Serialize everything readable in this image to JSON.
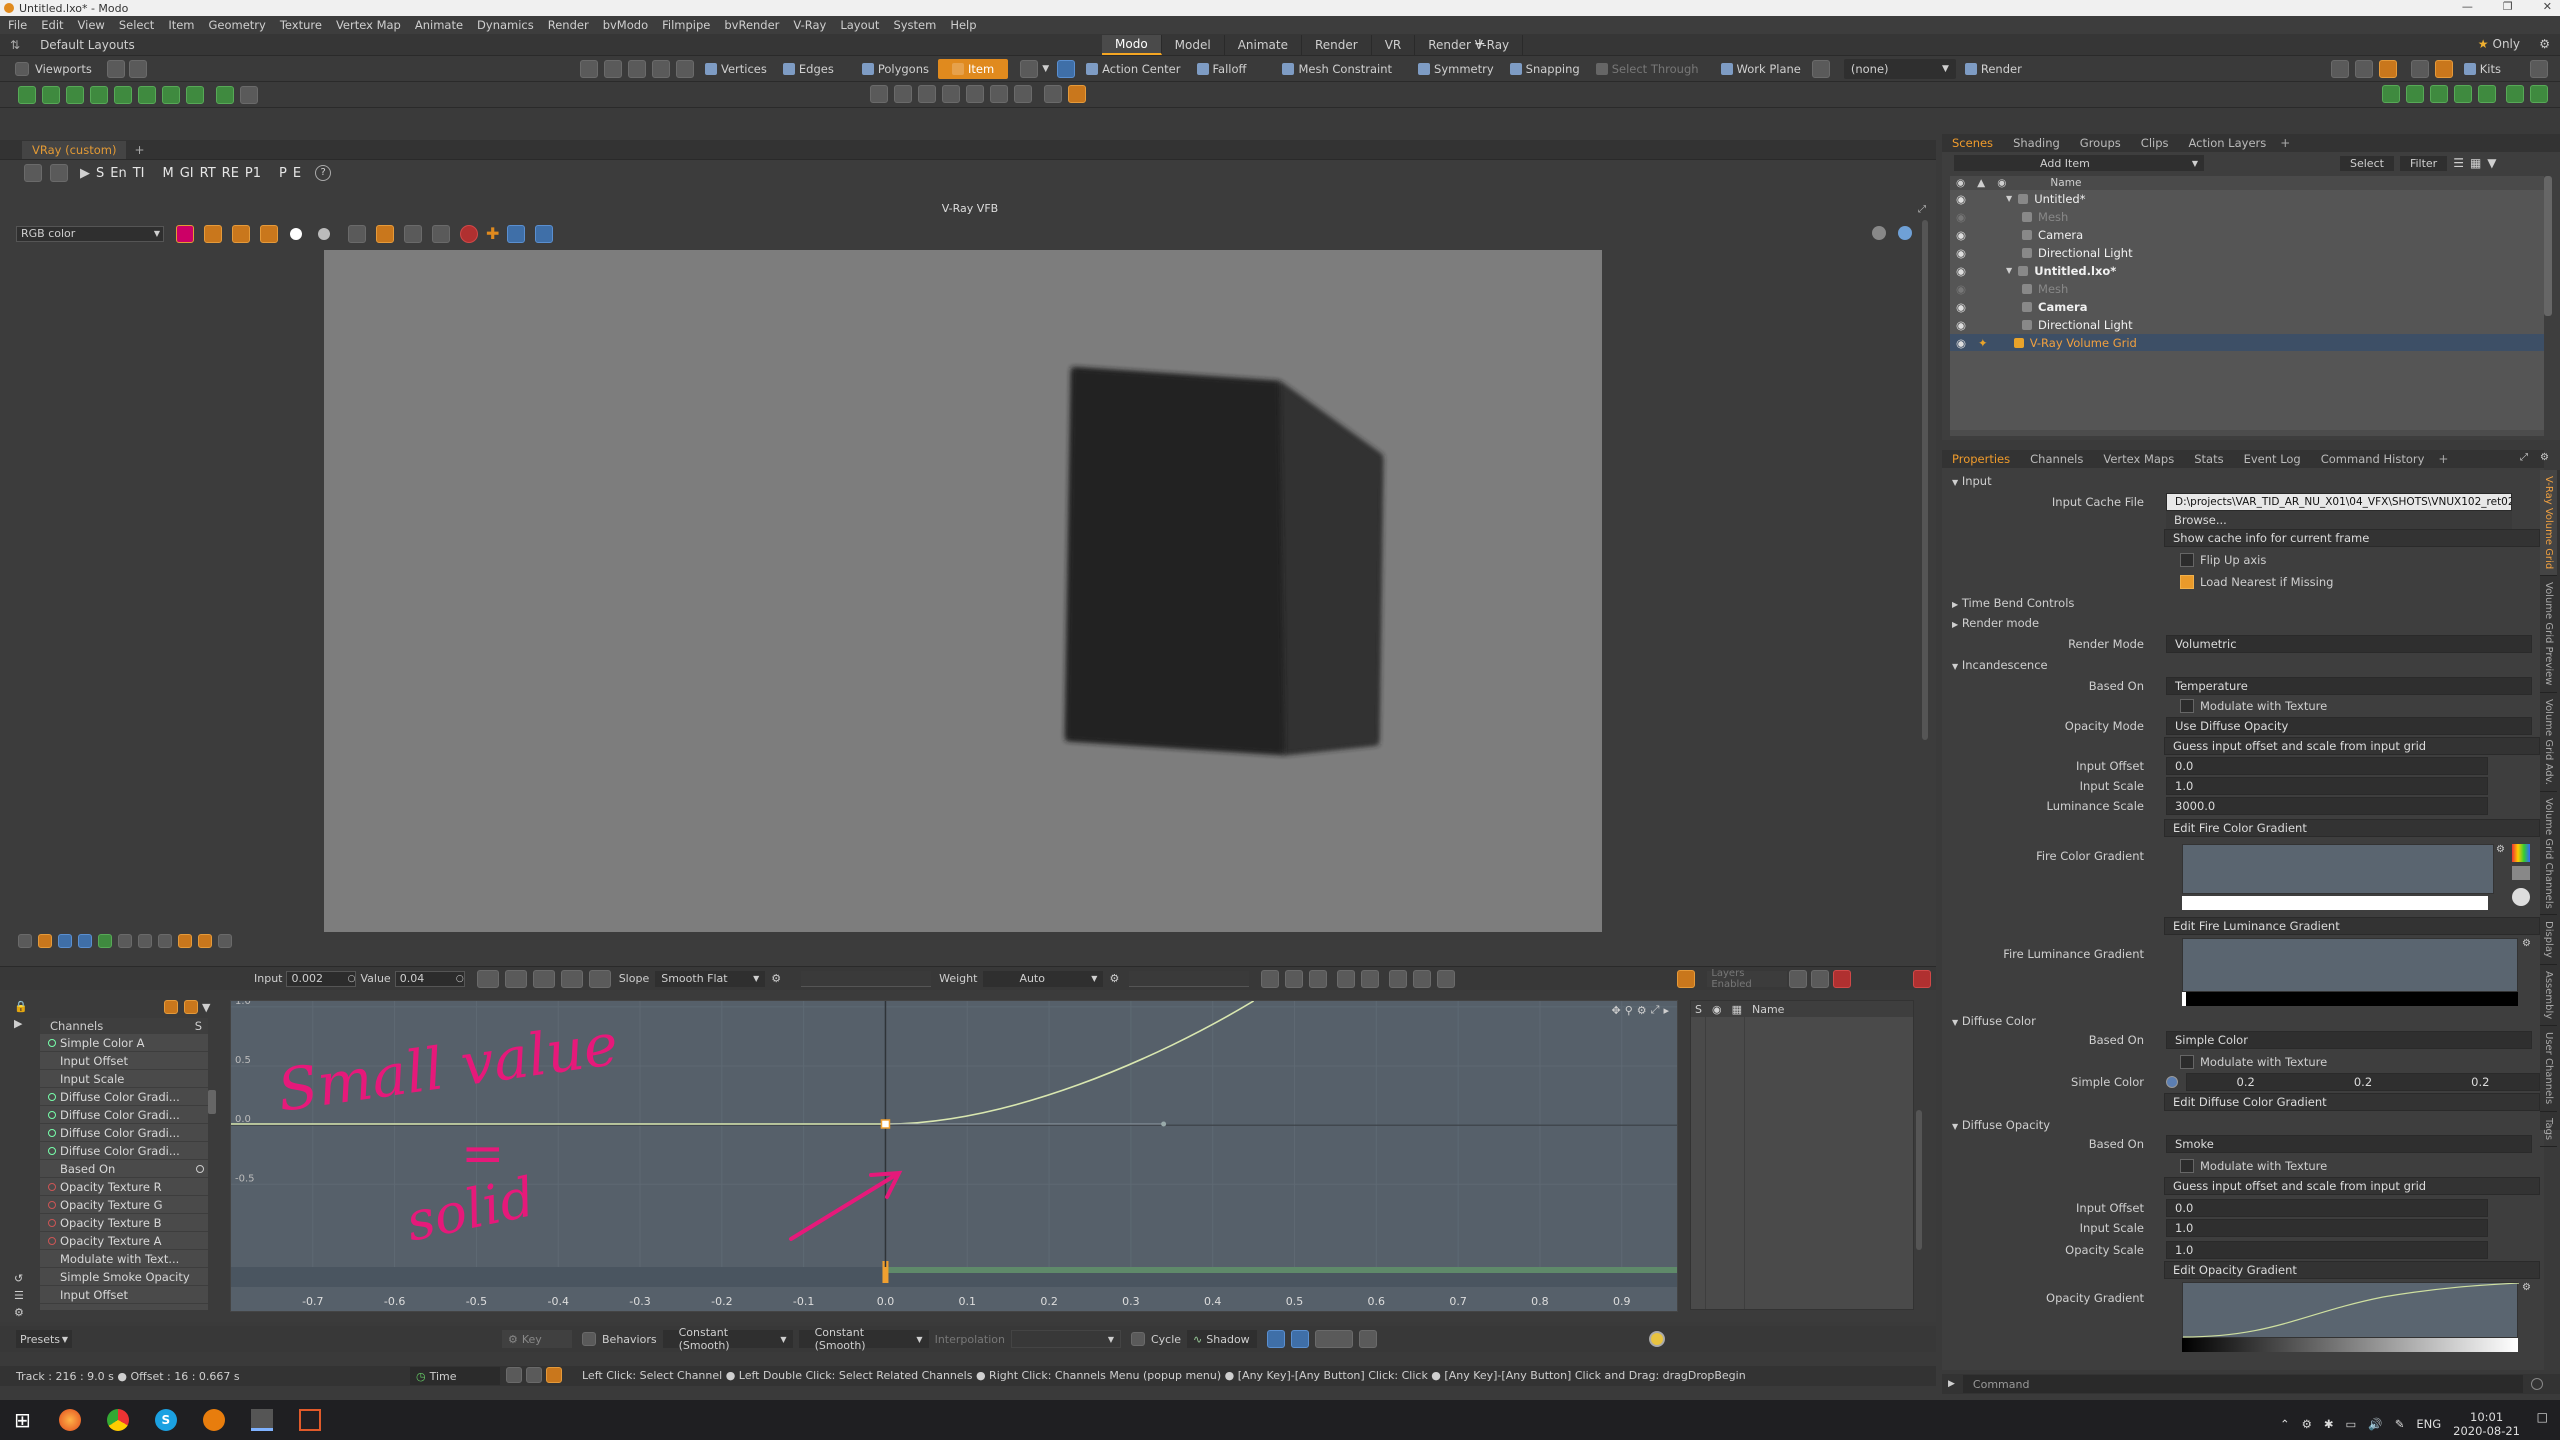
{
  "titlebar": {
    "title": "Untitled.lxo* - Modo"
  },
  "menus": [
    "File",
    "Edit",
    "View",
    "Select",
    "Item",
    "Geometry",
    "Texture",
    "Vertex Map",
    "Animate",
    "Dynamics",
    "Render",
    "bvModo",
    "Filmpipe",
    "bvRender",
    "V-Ray",
    "Layout",
    "System",
    "Help"
  ],
  "layout_tabs": {
    "layout_name": "Default Layouts",
    "tabs": [
      "Modo",
      "Model",
      "Animate",
      "Render",
      "VR",
      "Render V-Ray"
    ],
    "active": "Modo",
    "only_label": "Only"
  },
  "toolbar": {
    "viewports": "Viewports",
    "vertices": "Vertices",
    "edges": "Edges",
    "polygons": "Polygons",
    "item": "Item",
    "action_center": "Action Center",
    "falloff": "Falloff",
    "mesh_constraint": "Mesh Constraint",
    "symmetry": "Symmetry",
    "snapping": "Snapping",
    "select_through": "Select Through",
    "work_plane": "Work Plane",
    "none": "(none)",
    "render": "Render",
    "kits": "Kits"
  },
  "viewport": {
    "tab": "VRay (custom)",
    "vfb_title": "V-Ray VFB",
    "channel_select": "RGB color",
    "vfb_buttons": [
      "S",
      "En",
      "TI",
      "M",
      "GI",
      "RT",
      "RE",
      "P1",
      "P",
      "E"
    ]
  },
  "graph": {
    "input_label": "Input",
    "input_value": "0.002",
    "value_label": "Value",
    "value_value": "0.04",
    "slope_label": "Slope",
    "slope_value": "Smooth Flat",
    "weight_label": "Weight",
    "weight_value": "Auto",
    "layers_label": "Layers Enabled",
    "name_col": "Name",
    "s_col": "S",
    "channels_header": "Channels",
    "channels": [
      "Simple Color A",
      "Input Offset",
      "Input Scale",
      "Diffuse Color Gradi...",
      "Diffuse Color Gradi...",
      "Diffuse Color Gradi...",
      "Diffuse Color Gradi...",
      "Based On",
      "Opacity Texture R",
      "Opacity Texture G",
      "Opacity Texture B",
      "Opacity Texture A",
      "Modulate with Text...",
      "Simple Smoke Opacity",
      "Input Offset"
    ],
    "x_ticks": [
      "-0.7",
      "-0.6",
      "-0.5",
      "-0.4",
      "-0.3",
      "-0.2",
      "-0.1",
      "0.0",
      "0.1",
      "0.2",
      "0.3",
      "0.4",
      "0.5",
      "0.6",
      "0.7",
      "0.8",
      "0.9"
    ],
    "y_ticks": [
      "1.0",
      "0.5",
      "0.0",
      "-0.5"
    ],
    "annotation_line1": "Small value",
    "annotation_eq": "=",
    "annotation_line2": "solid",
    "presets": "Presets",
    "key": "Key",
    "behaviors": "Behaviors",
    "constant1": "Constant (Smooth)",
    "constant2": "Constant (Smooth)",
    "interpolation": "Interpolation",
    "cycle": "Cycle",
    "shadow": "Shadow"
  },
  "status": {
    "track": "Track : 216 : 9.0 s ● Offset : 16 : 0.667 s",
    "time": "Time",
    "hints": "Left Click: Select Channel ● Left Double Click: Select Related Channels ● Right Click: Channels Menu (popup menu) ● [Any Key]-[Any Button] Click: Click ● [Any Key]-[Any Button] Click and Drag: dragDropBegin",
    "command": "Command"
  },
  "scenes": {
    "tabs": [
      "Scenes",
      "Shading",
      "Groups",
      "Clips",
      "Action Layers"
    ],
    "add_item": "Add Item",
    "select": "Select",
    "filter": "Filter",
    "name_col": "Name",
    "items": [
      {
        "label": "Untitled*",
        "dim": false,
        "indent": 0,
        "bold": false
      },
      {
        "label": "Mesh",
        "dim": true,
        "indent": 1,
        "bold": false
      },
      {
        "label": "Camera",
        "dim": false,
        "indent": 1,
        "bold": false
      },
      {
        "label": "Directional Light",
        "dim": false,
        "indent": 1,
        "bold": false
      },
      {
        "label": "Untitled.lxo*",
        "dim": false,
        "indent": 0,
        "bold": true
      },
      {
        "label": "Mesh",
        "dim": true,
        "indent": 1,
        "bold": false
      },
      {
        "label": "Camera",
        "dim": false,
        "indent": 1,
        "bold": true
      },
      {
        "label": "Directional Light",
        "dim": false,
        "indent": 1,
        "bold": false
      },
      {
        "label": "V-Ray Volume Grid",
        "dim": false,
        "indent": 1,
        "bold": false,
        "selected": true
      }
    ]
  },
  "properties": {
    "tabs": [
      "Properties",
      "Channels",
      "Vertex Maps",
      "Stats",
      "Event Log",
      "Command History"
    ],
    "input_section": "Input",
    "input_cache_file_label": "Input Cache File",
    "input_cache_file": "D:\\projects\\VAR_TID_AR_NU_X01\\04_VFX\\SHOTS\\VNUX102_ret02\\",
    "browse": "Browse...",
    "show_cache": "Show cache info for current frame",
    "flip_up": "Flip Up axis",
    "load_nearest": "Load Nearest if Missing",
    "time_bend": "Time Bend Controls",
    "render_mode_section": "Render mode",
    "render_mode_label": "Render Mode",
    "render_mode": "Volumetric",
    "incandescence": "Incandescence",
    "based_on_label": "Based On",
    "based_on_inc": "Temperature",
    "modulate": "Modulate with Texture",
    "opacity_mode_label": "Opacity Mode",
    "opacity_mode": "Use Diffuse Opacity",
    "guess": "Guess input offset and scale from input grid",
    "input_offset_label": "Input Offset",
    "input_offset": "0.0",
    "input_scale_label": "Input Scale",
    "input_scale": "1.0",
    "luminance_scale_label": "Luminance Scale",
    "luminance_scale": "3000.0",
    "edit_fire_color": "Edit Fire Color Gradient",
    "fire_color_label": "Fire Color Gradient",
    "edit_fire_lum": "Edit Fire Luminance Gradient",
    "fire_lum_label": "Fire Luminance Gradient",
    "diffuse_color": "Diffuse Color",
    "based_on_diff": "Simple Color",
    "simple_color_label": "Simple Color",
    "simple_color": [
      "0.2",
      "0.2",
      "0.2"
    ],
    "edit_diffuse": "Edit Diffuse Color Gradient",
    "diffuse_opacity": "Diffuse Opacity",
    "based_on_op": "Smoke",
    "input_offset2": "0.0",
    "input_scale2": "1.0",
    "opacity_scale_label": "Opacity Scale",
    "opacity_scale": "1.0",
    "edit_opacity": "Edit Opacity Gradient",
    "opacity_gradient_label": "Opacity Gradient",
    "side_tabs": [
      "V-Ray Volume Grid",
      "Volume Grid Preview",
      "Volume Grid Adv.",
      "Volume Grid Channels",
      "Display",
      "Assembly",
      "User Channels",
      "Tags"
    ]
  },
  "taskbar": {
    "lang": "ENG",
    "time": "10:01",
    "date": "2020-08-21"
  }
}
